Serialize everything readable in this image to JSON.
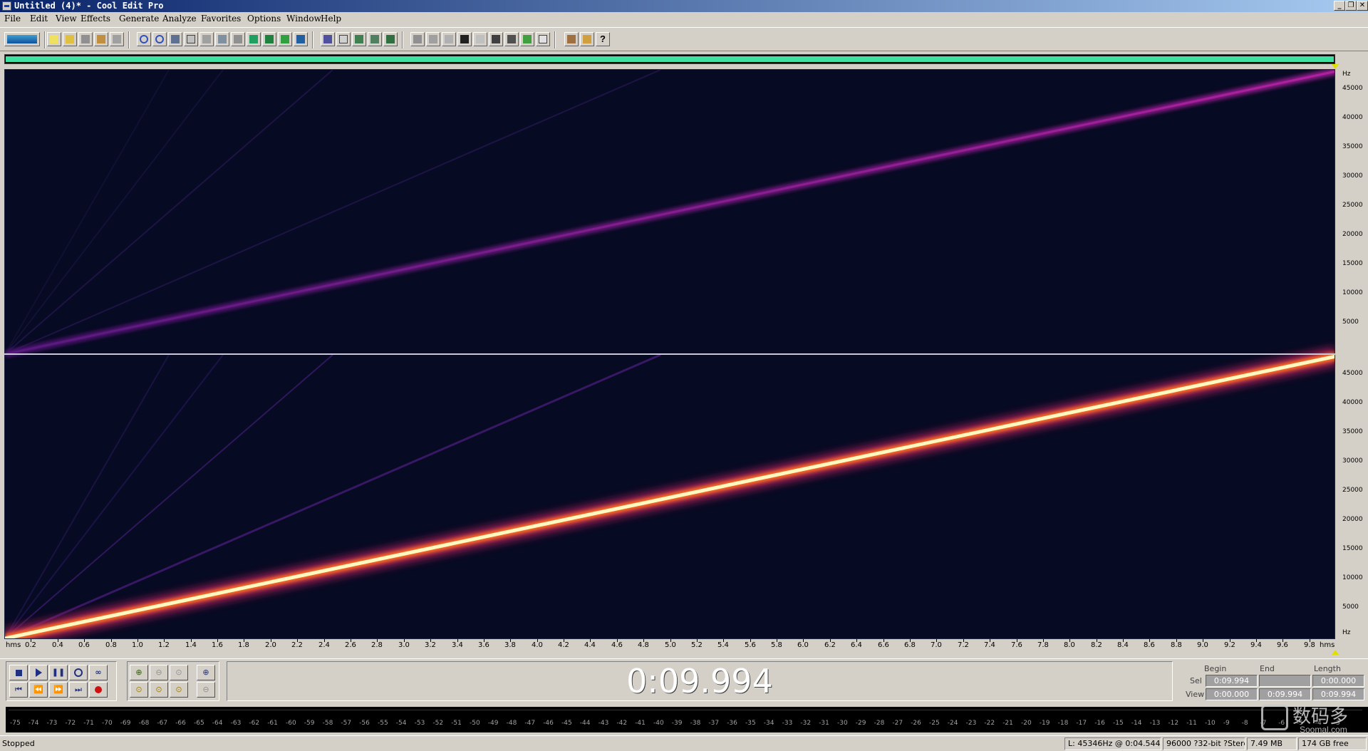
{
  "window": {
    "title": "Untitled (4)* - Cool Edit Pro",
    "minimize": "_",
    "restore": "❐",
    "close": "✕"
  },
  "menu": [
    "File",
    "Edit",
    "View",
    "Effects",
    "Generate",
    "Analyze",
    "Favorites",
    "Options",
    "Window",
    "Help"
  ],
  "hz_ruler": {
    "unit_top": "Hz",
    "unit_bottom": "Hz",
    "ticks": [
      "45000",
      "40000",
      "35000",
      "30000",
      "25000",
      "20000",
      "15000",
      "10000",
      "5000"
    ]
  },
  "time_ruler": {
    "start_label": "hms",
    "end_label": "hms",
    "ticks": [
      "0.2",
      "0.4",
      "0.6",
      "0.8",
      "1.0",
      "1.2",
      "1.4",
      "1.6",
      "1.8",
      "2.0",
      "2.2",
      "2.4",
      "2.6",
      "2.8",
      "3.0",
      "3.2",
      "3.4",
      "3.6",
      "3.8",
      "4.0",
      "4.2",
      "4.4",
      "4.6",
      "4.8",
      "5.0",
      "5.2",
      "5.4",
      "5.6",
      "5.8",
      "6.0",
      "6.2",
      "6.4",
      "6.6",
      "6.8",
      "7.0",
      "7.2",
      "7.4",
      "7.6",
      "7.8",
      "8.0",
      "8.2",
      "8.4",
      "8.6",
      "8.8",
      "9.0",
      "9.2",
      "9.4",
      "9.6",
      "9.8"
    ]
  },
  "time_display": "0:09.994",
  "selview": {
    "headers": {
      "begin": "Begin",
      "end": "End",
      "length": "Length"
    },
    "sel": {
      "label": "Sel",
      "begin": "0:09.994",
      "end": "",
      "length": "0:00.000"
    },
    "view": {
      "label": "View",
      "begin": "0:00.000",
      "end": "0:09.994",
      "length": "0:09.994"
    }
  },
  "meter_labels": [
    "-75",
    "-74",
    "-73",
    "-72",
    "-71",
    "-70",
    "-69",
    "-68",
    "-67",
    "-66",
    "-65",
    "-64",
    "-63",
    "-62",
    "-61",
    "-60",
    "-59",
    "-58",
    "-57",
    "-56",
    "-55",
    "-54",
    "-53",
    "-52",
    "-51",
    "-50",
    "-49",
    "-48",
    "-47",
    "-46",
    "-45",
    "-44",
    "-43",
    "-42",
    "-41",
    "-40",
    "-39",
    "-38",
    "-37",
    "-36",
    "-35",
    "-34",
    "-33",
    "-32",
    "-31",
    "-30",
    "-29",
    "-28",
    "-27",
    "-26",
    "-25",
    "-24",
    "-23",
    "-22",
    "-21",
    "-20",
    "-19",
    "-18",
    "-17",
    "-16",
    "-15",
    "-14",
    "-13",
    "-12",
    "-11",
    "-10",
    "-9",
    "-8",
    "-7",
    "-6",
    "-5",
    "-4",
    "-3"
  ],
  "status": {
    "state": "Stopped",
    "cursor": "L: 45346Hz @   0:04.544",
    "format": "96000 ?32-bit ?Stereo",
    "size": "7.49 MB",
    "free": "174 GB free"
  },
  "watermark": {
    "cn": "数码多",
    "en": "Soomal.com"
  },
  "colors": {
    "spectrogram_bg": "#060a22",
    "left_sweep": "#a020a0",
    "right_sweep_core": "#fff8c0",
    "right_sweep_glow": "#ff7020",
    "overview_fill": "#40e0a0"
  }
}
